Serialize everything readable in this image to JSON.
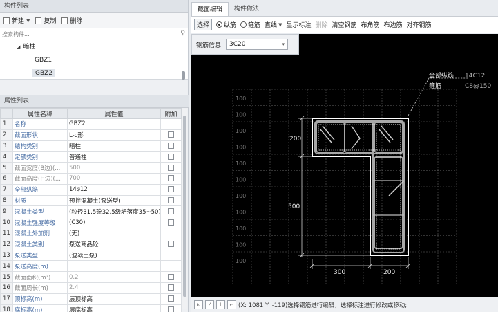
{
  "component_panel": {
    "title": "构件列表",
    "toolbar": [
      {
        "label": "新建",
        "icon": "new-doc-icon",
        "has_dropdown": true
      },
      {
        "label": "复制",
        "icon": "copy-icon"
      },
      {
        "label": "删除",
        "icon": "delete-icon"
      }
    ],
    "search_placeholder": "搜索构件...",
    "tree": {
      "parent": "暗柱",
      "children": [
        "GBZ1",
        "GBZ2"
      ],
      "selected": "GBZ2"
    }
  },
  "property_panel": {
    "title": "属性列表",
    "columns": [
      "属性名称",
      "属性值",
      "附加"
    ],
    "rows": [
      {
        "num": "1",
        "name": "名称",
        "value": "GBZ2",
        "check": false,
        "disabled": false
      },
      {
        "num": "2",
        "name": "截面形状",
        "value": "L-c形",
        "check": true,
        "disabled": false
      },
      {
        "num": "3",
        "name": "结构类别",
        "value": "暗柱",
        "check": true,
        "disabled": false
      },
      {
        "num": "4",
        "name": "定额类别",
        "value": "普通柱",
        "check": true,
        "disabled": false
      },
      {
        "num": "5",
        "name": "截面宽度(B边)(...",
        "value": "500",
        "check": true,
        "disabled": true
      },
      {
        "num": "6",
        "name": "截面高度(H边)(...",
        "value": "700",
        "check": true,
        "disabled": true
      },
      {
        "num": "7",
        "name": "全部纵筋",
        "value": "14⌀12",
        "check": true,
        "disabled": false
      },
      {
        "num": "8",
        "name": "材质",
        "value": "预拌混凝土(泵送型)",
        "check": true,
        "disabled": false
      },
      {
        "num": "9",
        "name": "混凝土类型",
        "value": "(粒径31.5砼32.5级坍落度35~50)",
        "check": true,
        "disabled": false
      },
      {
        "num": "10",
        "name": "混凝土强度等级",
        "value": "(C30)",
        "check": true,
        "disabled": false
      },
      {
        "num": "11",
        "name": "混凝土外加剂",
        "value": "(无)",
        "check": false,
        "disabled": false
      },
      {
        "num": "12",
        "name": "混凝土类别",
        "value": "泵送商品砼",
        "check": true,
        "disabled": false
      },
      {
        "num": "13",
        "name": "泵送类型",
        "value": "(混凝土泵)",
        "check": false,
        "disabled": false
      },
      {
        "num": "14",
        "name": "泵送高度(m)",
        "value": "",
        "check": false,
        "disabled": false
      },
      {
        "num": "15",
        "name": "截面面积(m²)",
        "value": "0.2",
        "check": true,
        "disabled": true
      },
      {
        "num": "16",
        "name": "截面周长(m)",
        "value": "2.4",
        "check": true,
        "disabled": true
      },
      {
        "num": "17",
        "name": "顶标高(m)",
        "value": "层顶标高",
        "check": true,
        "disabled": false
      },
      {
        "num": "18",
        "name": "底标高(m)",
        "value": "层底标高",
        "check": true,
        "disabled": false
      }
    ]
  },
  "tabs": [
    {
      "label": "截面编辑",
      "active": true
    },
    {
      "label": "构件做法",
      "active": false
    }
  ],
  "edit_toolbar": {
    "select": "选择",
    "radio_longitudinal": "纵筋",
    "radio_stirrup": "箍筋",
    "line": "直线",
    "show_annotation": "显示标注",
    "delete": "删除",
    "clear_rebar": "清空钢筋",
    "corner_rebar": "布角筋",
    "edge_rebar": "布边筋",
    "align_rebar": "对齐钢筋"
  },
  "rebar_info": {
    "label": "钢筋信息:",
    "value": "3C20"
  },
  "drawing": {
    "grid_label": "100",
    "annotation_long_label": "全部纵筋",
    "annotation_long_value": "14C12",
    "annotation_stirrup_label": "箍筋",
    "annotation_stirrup_value": "C8@150",
    "dim_top": "200",
    "dim_left": "500",
    "dim_bottom_left": "300",
    "dim_bottom_right": "200"
  },
  "status": {
    "text": "(X: 1081 Y: -119)选择钢筋进行编辑，选择标注进行修改或移动;"
  },
  "colors": {
    "canvas_bg": "#000000",
    "grid": "#6b6b6b",
    "outline": "#ffffff",
    "rebar": "#9a9a9a",
    "accent_text": "#cfcfcf"
  }
}
